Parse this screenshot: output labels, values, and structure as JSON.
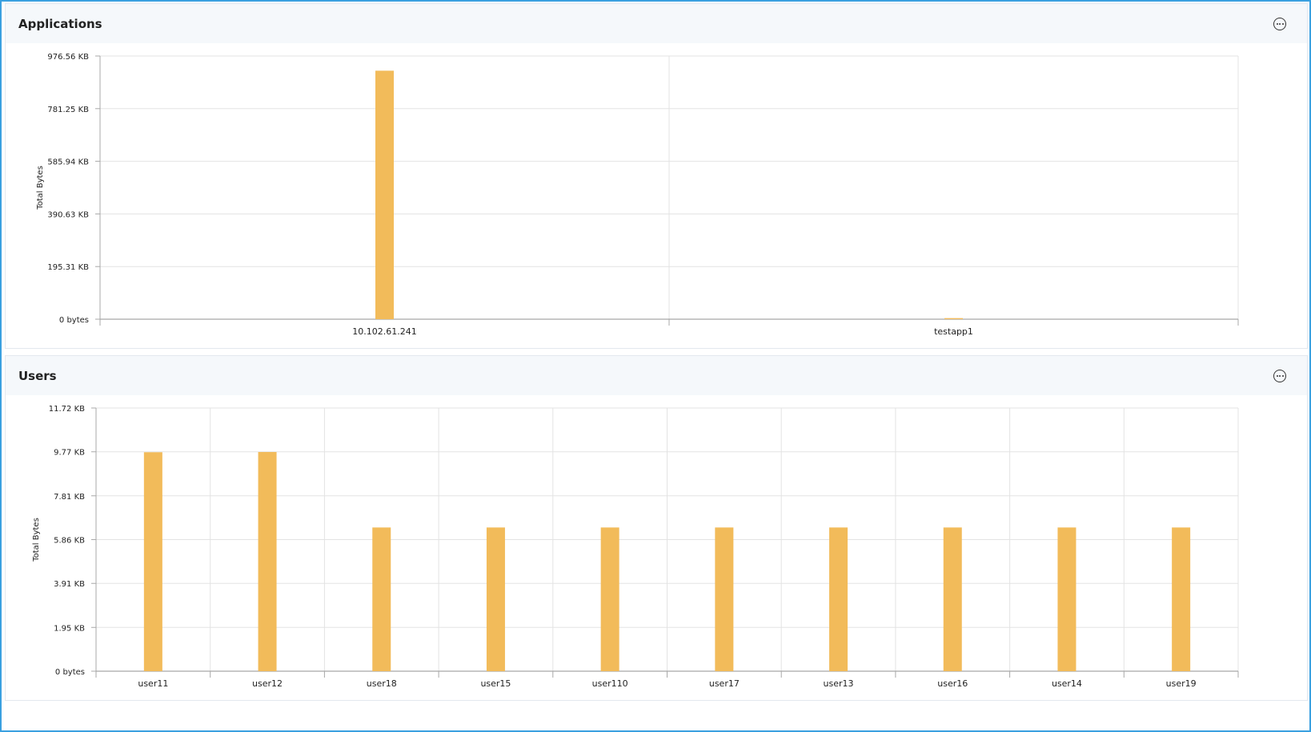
{
  "colors": {
    "bar": "#f2bb5a",
    "grid": "#e3e3e3",
    "axis": "#a8a8a8",
    "header_bg": "#f5f8fb",
    "frame_border": "#3aa0e0"
  },
  "icons": {
    "panel_menu": "more-horizontal-circle-icon"
  },
  "panels": [
    {
      "title": "Applications",
      "chart_data": {
        "type": "bar",
        "ylabel": "Total Bytes",
        "xlabel": "",
        "y_unit": "KB",
        "ylim": [
          0,
          976.56
        ],
        "y_ticks": [
          {
            "value": 0,
            "label": "0 bytes"
          },
          {
            "value": 195.31,
            "label": "195.31 KB"
          },
          {
            "value": 390.63,
            "label": "390.63 KB"
          },
          {
            "value": 585.94,
            "label": "585.94 KB"
          },
          {
            "value": 781.25,
            "label": "781.25 KB"
          },
          {
            "value": 976.56,
            "label": "976.56 KB"
          }
        ],
        "categories": [
          "10.102.61.241",
          "testapp1"
        ],
        "values": [
          922,
          4
        ],
        "grid": true
      }
    },
    {
      "title": "Users",
      "chart_data": {
        "type": "bar",
        "ylabel": "Total Bytes",
        "xlabel": "",
        "y_unit": "KB",
        "ylim": [
          0,
          11.72
        ],
        "y_ticks": [
          {
            "value": 0,
            "label": "0 bytes"
          },
          {
            "value": 1.95,
            "label": "1.95 KB"
          },
          {
            "value": 3.91,
            "label": "3.91 KB"
          },
          {
            "value": 5.86,
            "label": "5.86 KB"
          },
          {
            "value": 7.81,
            "label": "7.81 KB"
          },
          {
            "value": 9.77,
            "label": "9.77 KB"
          },
          {
            "value": 11.72,
            "label": "11.72 KB"
          }
        ],
        "categories": [
          "user11",
          "user12",
          "user18",
          "user15",
          "user110",
          "user17",
          "user13",
          "user16",
          "user14",
          "user19"
        ],
        "values": [
          9.75,
          9.76,
          6.4,
          6.4,
          6.4,
          6.4,
          6.4,
          6.4,
          6.4,
          6.4
        ],
        "grid": true
      }
    }
  ]
}
